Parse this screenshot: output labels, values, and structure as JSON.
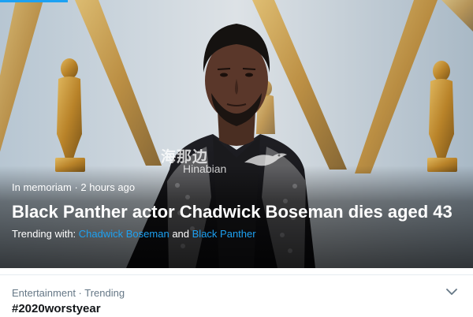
{
  "hero": {
    "meta": "In memoriam · 2 hours ago",
    "headline": "Black Panther actor Chadwick Boseman dies aged 43",
    "trending_prefix": "Trending with:",
    "trending_link_1": "Chadwick Boseman",
    "trending_and": "and",
    "trending_link_2": "Black Panther"
  },
  "watermark": {
    "chinese": "海那边",
    "latin": "Hinabian"
  },
  "trend_card": {
    "meta": "Entertainment · Trending",
    "title": "#2020worstyear"
  },
  "colors": {
    "link": "#1da1f2",
    "card_text": "#14171a",
    "secondary_text": "#657786"
  },
  "icons": {
    "card_menu": "chevron-down-icon"
  }
}
